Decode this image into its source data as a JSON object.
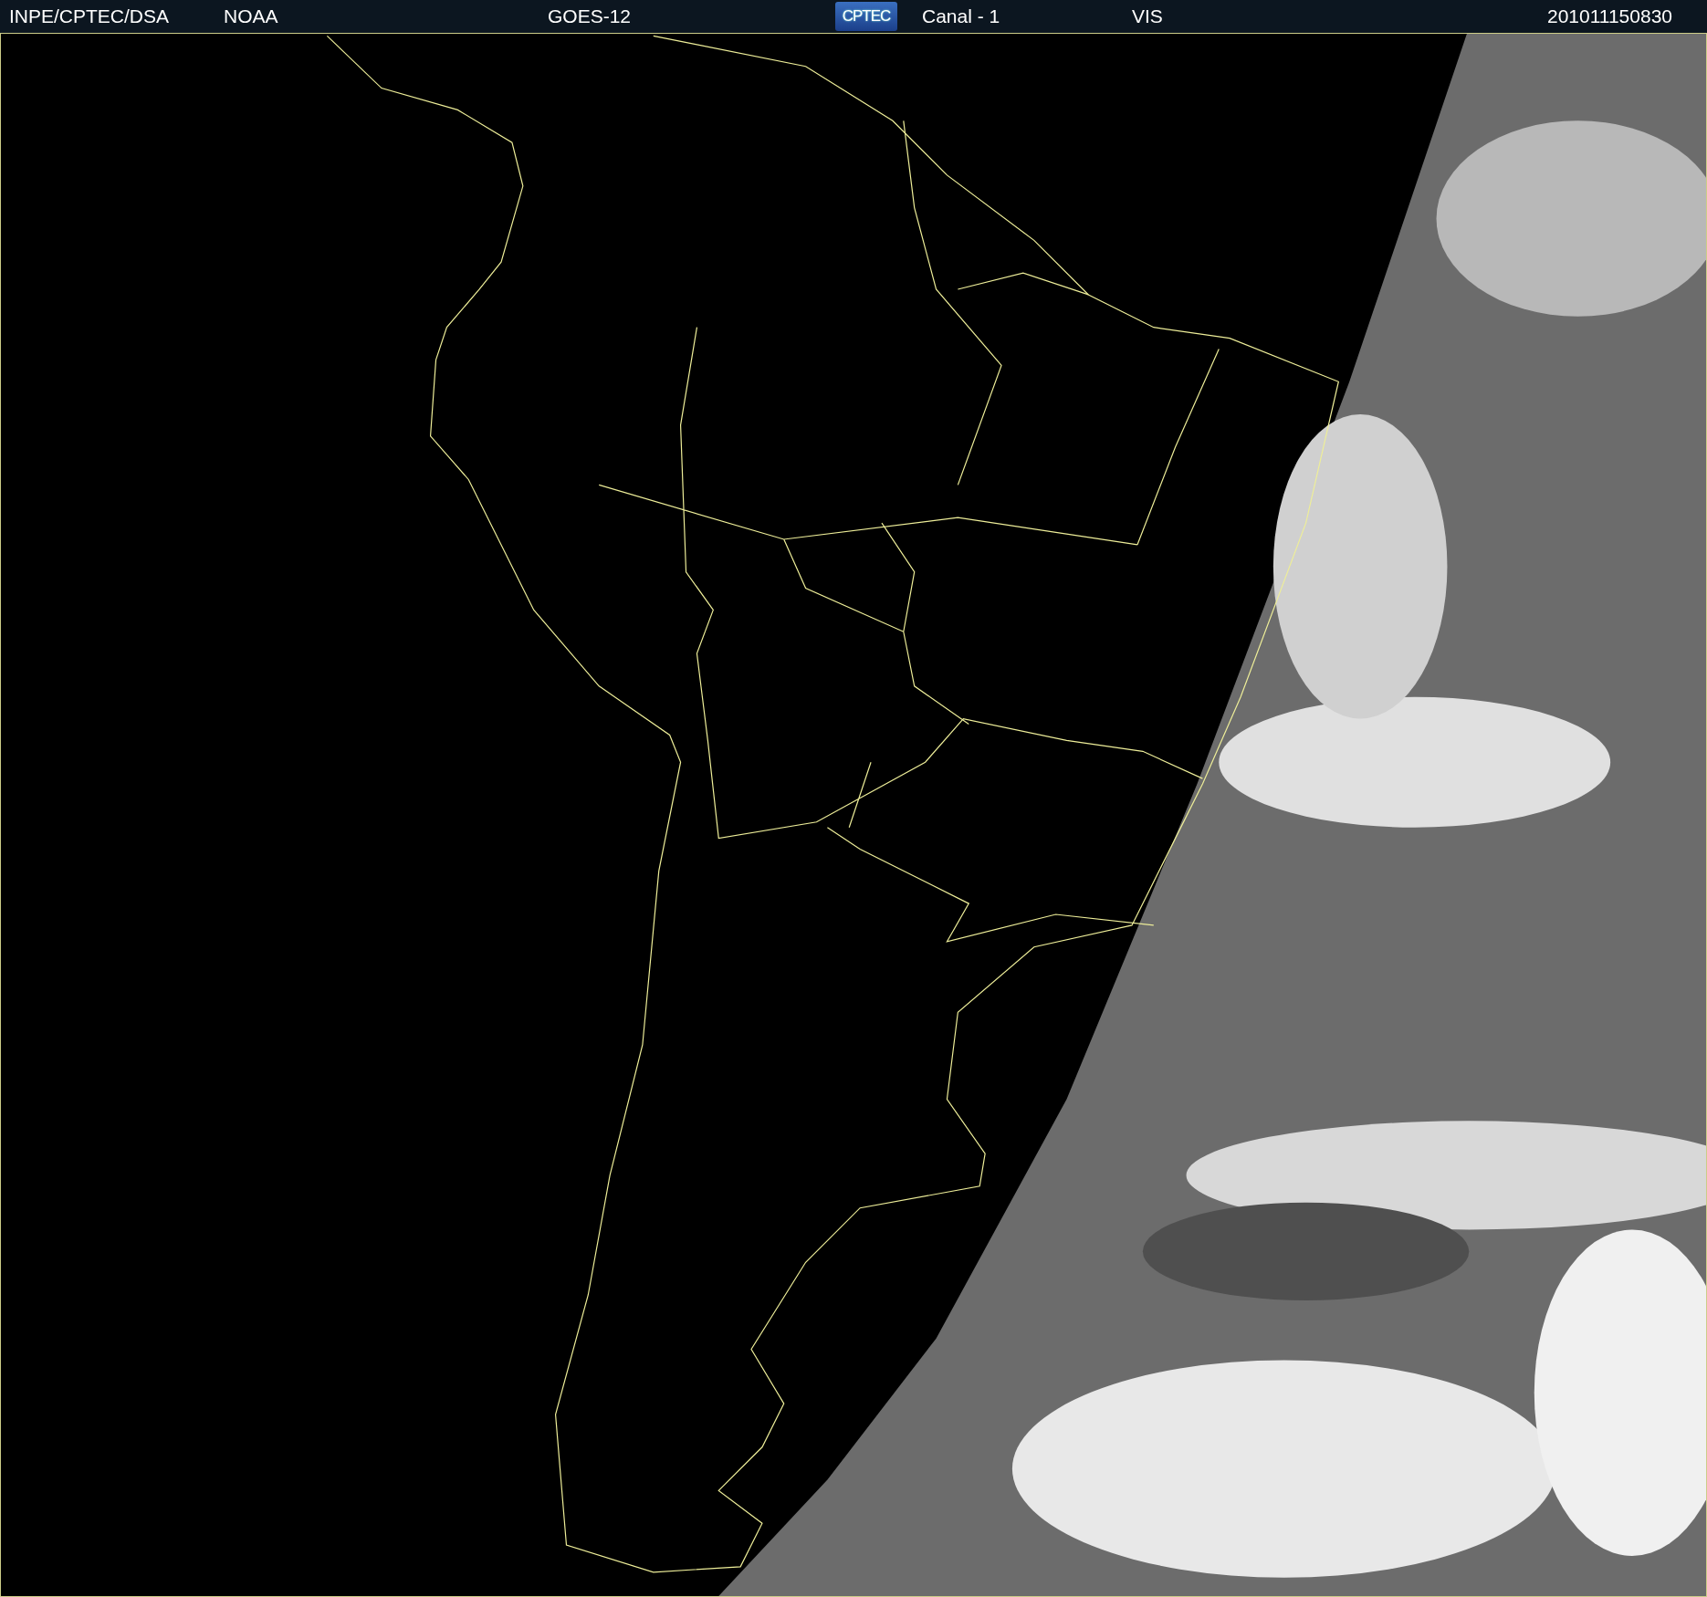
{
  "header": {
    "items": [
      {
        "kind": "text",
        "text": "INPE/CPTEC/DSA"
      },
      {
        "kind": "text",
        "text": "NOAA"
      },
      {
        "kind": "text",
        "text": "GOES-12"
      },
      {
        "kind": "logo",
        "text": "CPTEC"
      },
      {
        "kind": "text",
        "text": "Canal - 1"
      },
      {
        "kind": "text",
        "text": "VIS"
      },
      {
        "kind": "text",
        "text": "201011150830"
      }
    ]
  }
}
